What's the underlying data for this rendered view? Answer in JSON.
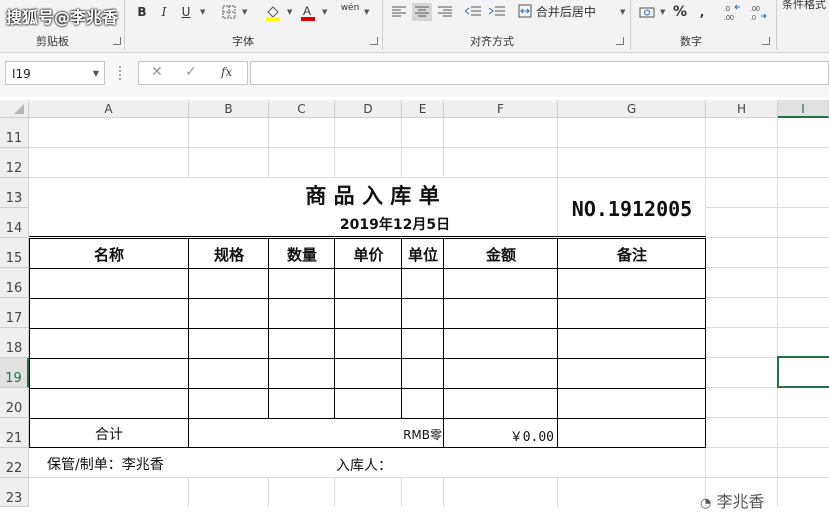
{
  "watermark": "搜狐号@李兆香",
  "watermark_bottom": "李兆香",
  "ribbon": {
    "clipboard_label": "剪贴板",
    "font_label": "字体",
    "alignment_label": "对齐方式",
    "number_label": "数字",
    "merge_center": "合并后居中",
    "styles_label": "条件格式",
    "bold": "B",
    "italic": "I",
    "underline": "U",
    "phonetic": "wén",
    "percent": "%",
    "comma": ","
  },
  "formula_bar": {
    "name_box": "I19",
    "fx": "fx",
    "formula": ""
  },
  "columns": [
    "A",
    "B",
    "C",
    "D",
    "E",
    "F",
    "G",
    "H",
    "I"
  ],
  "rows": [
    "11",
    "12",
    "13",
    "14",
    "15",
    "16",
    "17",
    "18",
    "19",
    "20",
    "21",
    "22",
    "23"
  ],
  "form": {
    "title": "商 品 入 库 单",
    "date": "2019年12月5日",
    "number": "NO.1912005",
    "headers": [
      "名称",
      "规格",
      "数量",
      "单价",
      "单位",
      "金额",
      "备注"
    ],
    "total_label": "合计",
    "rmb_label": "RMB零",
    "total_amount": "￥0.00",
    "keeper": "保管/制单：李兆香",
    "receiver": "入库人："
  }
}
